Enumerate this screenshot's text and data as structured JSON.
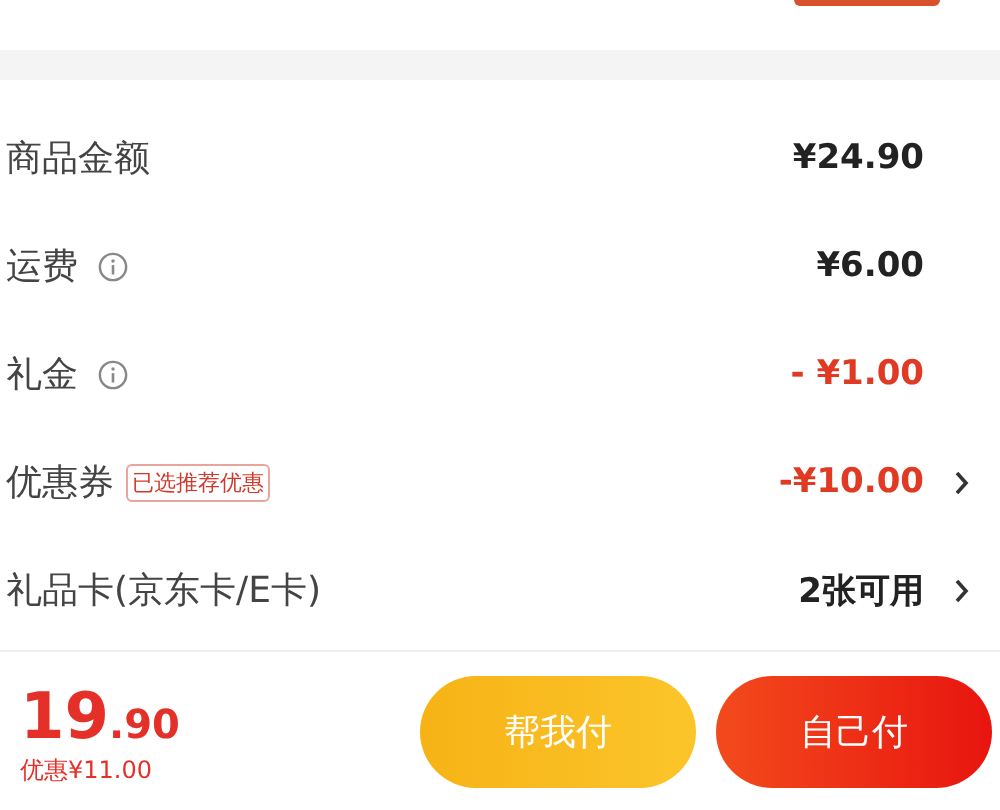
{
  "rows": [
    {
      "label": "商品金额",
      "info": false,
      "value": "¥24.90",
      "discount": false,
      "arrow": false
    },
    {
      "label": "运费",
      "info": true,
      "value": "¥6.00",
      "discount": false,
      "arrow": false
    },
    {
      "label": "礼金",
      "info": true,
      "value": "- ¥1.00",
      "discount": true,
      "arrow": false
    },
    {
      "label": "优惠券",
      "info": false,
      "tag": "已选推荐优惠",
      "value": "-¥10.00",
      "discount": true,
      "arrow": true
    },
    {
      "label": "礼品卡(京东卡/E卡)",
      "info": false,
      "value": "2张可用",
      "discount": false,
      "arrow": true
    }
  ],
  "footer": {
    "price_int": "19",
    "price_dec": ".90",
    "saving": "优惠¥11.00",
    "buttons": [
      {
        "label": "帮我付",
        "kind": "secondary"
      },
      {
        "label": "自己付",
        "kind": "primary"
      }
    ]
  }
}
